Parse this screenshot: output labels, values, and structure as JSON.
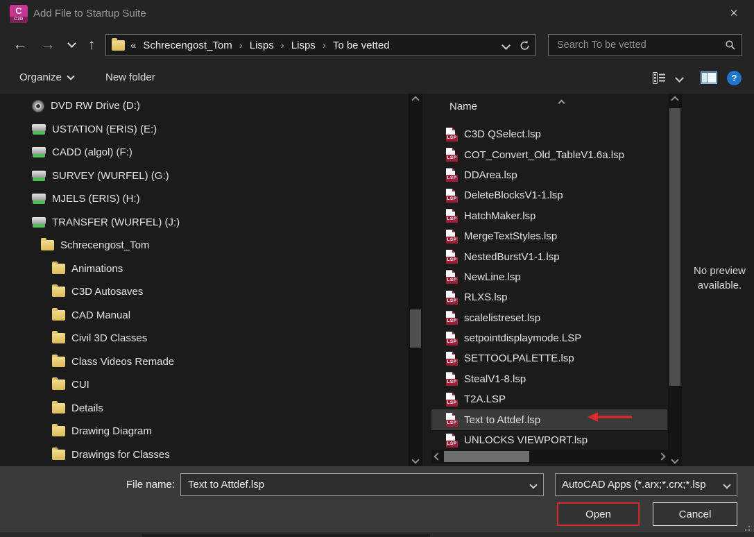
{
  "window": {
    "title": "Add File to Startup Suite"
  },
  "app_icon": {
    "letter": "C",
    "sub": "C3D"
  },
  "glyphs": {
    "close": "×",
    "back": "←",
    "forward": "→",
    "up": "↑",
    "overflow": "«",
    "crumb_sep": "›",
    "help": "?",
    "lsp_badge": "LSP"
  },
  "navbar": {
    "breadcrumb_items": [
      "Schrecengost_Tom",
      "Lisps",
      "Lisps",
      "To be vetted"
    ],
    "search_placeholder": "Search To be vetted"
  },
  "toolbar": {
    "organize_label": "Organize",
    "new_folder_label": "New folder"
  },
  "tree": {
    "items": [
      {
        "label": "DVD RW Drive (D:)",
        "icon": "dvd",
        "indent": 0
      },
      {
        "label": "USTATION (ERIS) (E:)",
        "icon": "netdrive",
        "indent": 0
      },
      {
        "label": "CADD (algol) (F:)",
        "icon": "netdrive",
        "indent": 0
      },
      {
        "label": "SURVEY (WURFEL) (G:)",
        "icon": "netdrive",
        "indent": 0
      },
      {
        "label": "MJELS (ERIS) (H:)",
        "icon": "netdrive",
        "indent": 0
      },
      {
        "label": "TRANSFER (WURFEL) (J:)",
        "icon": "netdrive",
        "indent": 0
      },
      {
        "label": "Schrecengost_Tom",
        "icon": "folder",
        "indent": 1
      },
      {
        "label": "Animations",
        "icon": "folder",
        "indent": 2
      },
      {
        "label": "C3D Autosaves",
        "icon": "folder",
        "indent": 2
      },
      {
        "label": "CAD Manual",
        "icon": "folder",
        "indent": 2
      },
      {
        "label": "Civil 3D Classes",
        "icon": "folder",
        "indent": 2
      },
      {
        "label": "Class Videos Remade",
        "icon": "folder",
        "indent": 2
      },
      {
        "label": "CUI",
        "icon": "folder",
        "indent": 2
      },
      {
        "label": "Details",
        "icon": "folder",
        "indent": 2
      },
      {
        "label": "Drawing Diagram",
        "icon": "folder",
        "indent": 2
      },
      {
        "label": "Drawings for Classes",
        "icon": "folder",
        "indent": 2
      }
    ]
  },
  "filelist": {
    "column_header": "Name",
    "selected_index": 14,
    "files": [
      "C3D QSelect.lsp",
      "COT_Convert_Old_TableV1.6a.lsp",
      "DDArea.lsp",
      "DeleteBlocksV1-1.lsp",
      "HatchMaker.lsp",
      "MergeTextStyles.lsp",
      "NestedBurstV1-1.lsp",
      "NewLine.lsp",
      "RLXS.lsp",
      "scalelistreset.lsp",
      "setpointdisplaymode.LSP",
      "SETTOOLPALETTE.lsp",
      "StealV1-8.lsp",
      "T2A.LSP",
      "Text to Attdef.lsp",
      "UNLOCKS VIEWPORT.lsp"
    ]
  },
  "preview": {
    "message": "No preview available."
  },
  "footer": {
    "file_name_label": "File name:",
    "file_name_value": "Text to Attdef.lsp",
    "file_type_value": "AutoCAD Apps (*.arx;*.crx;*.lsp",
    "open_label": "Open",
    "cancel_label": "Cancel"
  },
  "colors": {
    "annotation_red": "#d92b2b",
    "folder_yellow": "#e7c065",
    "lsp_red": "#9c1f37",
    "help_blue": "#1d76c9",
    "selection_bg": "#3a3a3a"
  }
}
